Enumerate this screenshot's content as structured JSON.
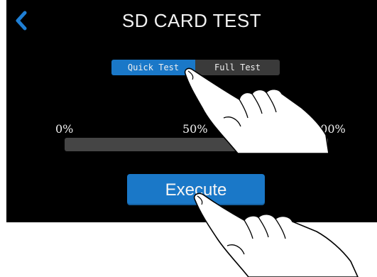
{
  "header": {
    "title": "SD CARD TEST",
    "back_icon": "chevron-left-icon"
  },
  "test_mode": {
    "options": [
      "Quick Test",
      "Full Test"
    ],
    "selected": "Quick Test"
  },
  "progress": {
    "labels": [
      "0%",
      "50%",
      "100%"
    ],
    "value_percent": 0
  },
  "execute_label": "Execute",
  "colors": {
    "accent": "#1a78c8",
    "background": "#000000",
    "track": "#454545",
    "inactive_segment": "#3a3a3a",
    "text": "#f0f0f0"
  },
  "overlay_icons": [
    "pointing-hand-icon",
    "pointing-hand-icon"
  ]
}
